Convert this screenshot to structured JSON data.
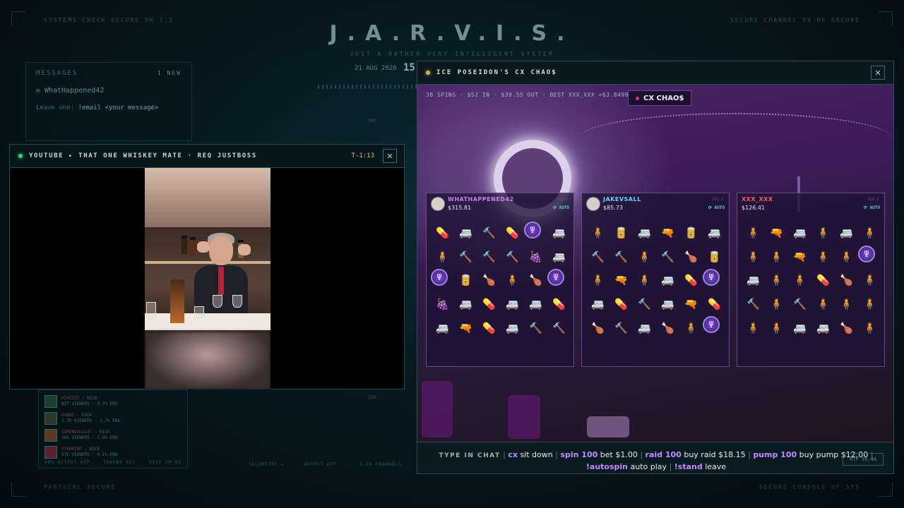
{
  "hud": {
    "top_left": "SYSTEMS CHECK SECURE OK 1.2",
    "top_right": "SECURE CHANNEL 99 OF SECURE",
    "bottom_left": "PROTOCOL SECURE",
    "bottom_right": "SECURE CONSOLE OF SYS"
  },
  "jarvis": {
    "title": "J.A.R.V.I.S.",
    "subtitle": "JUST A RATHER VERY INTELLIGENT SYSTEM",
    "date": "21 AUG 2026",
    "clock": "15"
  },
  "messages": {
    "header": "MESSAGES",
    "new_badge": "1 NEW",
    "user": "WhatHappened42",
    "hint_prefix": "Leave one:",
    "hint_cmd": "!email <your message>"
  },
  "feed": {
    "rows": [
      {
        "name": "HIVEZZZ",
        "platform": "KICK",
        "line": "NIT VIEWERS · 0.7% ENG"
      },
      {
        "name": "BUBBI",
        "platform": "KICK",
        "line": "3.7K VIEWERS · 1.2% ENG"
      },
      {
        "name": "SIMONSOLO247",
        "platform": "KICK",
        "line": "266 VIEWERS · 1.9% ENG"
      },
      {
        "name": "STARMIND",
        "platform": "KICK",
        "line": "576 VIEWERS · 0.1% ENG"
      }
    ],
    "foot_left": "90% OUTPUT ATP",
    "foot_mid": "TOKENS 815",
    "foot_right": "SKIP 20.85"
  },
  "telemetry": {
    "label": "TELEMETRY",
    "b": "OUTPUT ATP",
    "c": "9.7K CHANNELS"
  },
  "side_numbers": {
    "a": "100",
    "b": "220"
  },
  "youtube": {
    "title": "YOUTUBE ▸ THAT ONE WHISKEY MATE · REQ JUSTBOSS",
    "timer": "T-1:13",
    "close": "✕"
  },
  "cx": {
    "title": "ICE POSEIDON'S CX CHAO$",
    "close": "✕",
    "stats": "38 SPINS  ·  $52 IN  ·  $39.55 OUT  ·  BEST XXX_XXX +63.84999999999999",
    "badge": "CX CHAO$",
    "seats": [
      {
        "name": "WHATHAPPENED42",
        "name_color": "#c77dff",
        "balance": "$315.81",
        "rig": "RIG 1",
        "auto": "⟳ AUTO",
        "grid": [
          [
            "pill",
            "rv",
            "hammer",
            "pill",
            "trident",
            "rv"
          ],
          [
            "man",
            "hammer",
            "hammer",
            "hammer",
            "grape",
            "rv"
          ],
          [
            "trident",
            "can",
            "wings",
            "man",
            "wings",
            "trident"
          ],
          [
            "grape",
            "rv",
            "pill",
            "rv",
            "rv",
            "pill"
          ],
          [
            "rv",
            "gun",
            "pill",
            "rv",
            "hammer",
            "hammer"
          ]
        ]
      },
      {
        "name": "JAKEVSALL",
        "name_color": "#62d8ff",
        "balance": "$85.73",
        "rig": "RIG 2",
        "auto": "⟳ AUTO",
        "grid": [
          [
            "man",
            "can",
            "rv",
            "gun",
            "can",
            "rv"
          ],
          [
            "hammer",
            "hammer",
            "man",
            "hammer",
            "wings",
            "can"
          ],
          [
            "man",
            "gun",
            "man",
            "rv",
            "pill",
            "trident"
          ],
          [
            "rv",
            "pill",
            "hammer",
            "rv",
            "gun",
            "pill"
          ],
          [
            "wings",
            "hammer",
            "rv",
            "wings",
            "man",
            "trident"
          ]
        ]
      },
      {
        "name": "XXX_XXX",
        "name_color": "#ff5a5a",
        "balance": "$126.41",
        "rig": "RIG 3",
        "auto": "⟳ AUTO",
        "grid": [
          [
            "man",
            "gun",
            "rv",
            "man",
            "rv",
            "man"
          ],
          [
            "man",
            "man",
            "gun",
            "man",
            "man",
            "trident"
          ],
          [
            "rv",
            "man",
            "man",
            "pill",
            "wings",
            "man"
          ],
          [
            "hammer",
            "man",
            "hammer",
            "man",
            "man",
            "man"
          ],
          [
            "man",
            "man",
            "rv",
            "rv",
            "wings",
            "man"
          ]
        ]
      }
    ],
    "footer": {
      "type_in_chat": "TYPE IN CHAT",
      "cmds": [
        {
          "cmd": "cx",
          "desc": "sit down"
        },
        {
          "cmd": "spin 100",
          "desc": "bet $1.00"
        },
        {
          "cmd": "raid 100",
          "desc": "buy raid $18.15"
        },
        {
          "cmd": "pump 100",
          "desc": "buy pump $12.00"
        },
        {
          "cmd": "!autospin",
          "desc": "auto play"
        },
        {
          "cmd": "!stand",
          "desc": "leave"
        }
      ],
      "sep": "|"
    },
    "rtp": "RTP 99.44"
  },
  "symbol_glyphs": {
    "pill": "💊",
    "rv": "🚐",
    "hammer": "🔨",
    "trident": "Ψ",
    "can": "🥫",
    "man": "🧍",
    "wings": "🍗",
    "gun": "🔫",
    "grape": "🍇"
  }
}
